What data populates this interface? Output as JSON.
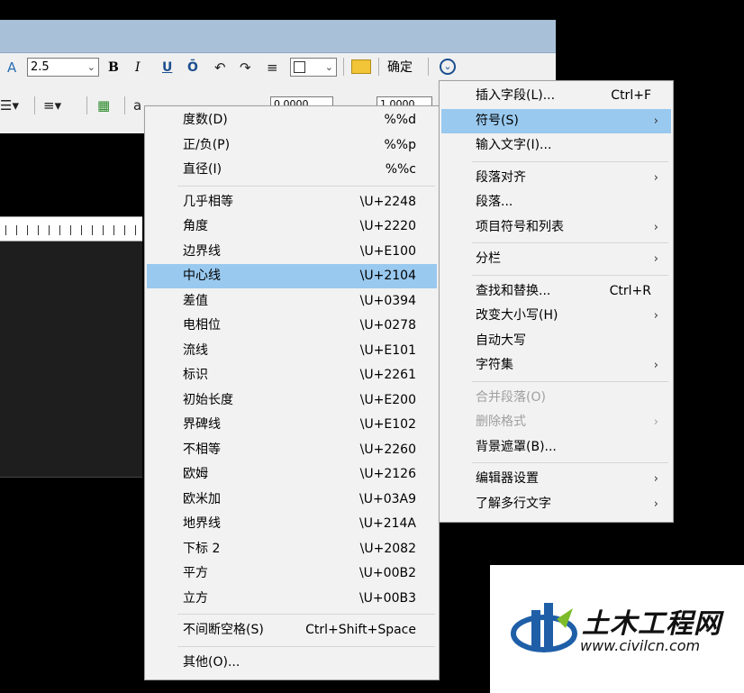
{
  "toolbar": {
    "row1": {
      "text_height_value": "2.5",
      "bold_label": "B",
      "italic_label": "I",
      "underline_label": "U",
      "overline_label": "Ō",
      "confirm_label": "确定"
    },
    "row2": {
      "oblique_value": "0.0000",
      "tracking_value": "1.0000"
    }
  },
  "symbol_menu": {
    "groups": [
      [
        {
          "label": "度数(D)",
          "code": "%%d"
        },
        {
          "label": "正/负(P)",
          "code": "%%p"
        },
        {
          "label": "直径(I)",
          "code": "%%c"
        }
      ],
      [
        {
          "label": "几乎相等",
          "code": "\\U+2248"
        },
        {
          "label": "角度",
          "code": "\\U+2220"
        },
        {
          "label": "边界线",
          "code": "\\U+E100"
        },
        {
          "label": "中心线",
          "code": "\\U+2104"
        },
        {
          "label": "差值",
          "code": "\\U+0394"
        },
        {
          "label": "电相位",
          "code": "\\U+0278"
        },
        {
          "label": "流线",
          "code": "\\U+E101"
        },
        {
          "label": "标识",
          "code": "\\U+2261"
        },
        {
          "label": "初始长度",
          "code": "\\U+E200"
        },
        {
          "label": "界碑线",
          "code": "\\U+E102"
        },
        {
          "label": "不相等",
          "code": "\\U+2260"
        },
        {
          "label": "欧姆",
          "code": "\\U+2126"
        },
        {
          "label": "欧米加",
          "code": "\\U+03A9"
        },
        {
          "label": "地界线",
          "code": "\\U+214A"
        },
        {
          "label": "下标 2",
          "code": "\\U+2082"
        },
        {
          "label": "平方",
          "code": "\\U+00B2"
        },
        {
          "label": "立方",
          "code": "\\U+00B3"
        }
      ],
      [
        {
          "label": "不间断空格(S)",
          "code": "Ctrl+Shift+Space"
        }
      ],
      [
        {
          "label": "其他(O)...",
          "code": ""
        }
      ]
    ],
    "highlighted": "中心线"
  },
  "options_menu": {
    "items": [
      {
        "label": "插入字段(L)...",
        "shortcut": "Ctrl+F"
      },
      {
        "label": "符号(S)",
        "arrow": "›"
      },
      {
        "label": "输入文字(I)..."
      },
      {
        "label": "段落对齐",
        "arrow": "›"
      },
      {
        "label": "段落..."
      },
      {
        "label": "项目符号和列表",
        "arrow": "›"
      },
      {
        "label": "分栏",
        "arrow": "›"
      },
      {
        "label": "查找和替换...",
        "shortcut": "Ctrl+R"
      },
      {
        "label": "改变大小写(H)",
        "arrow": "›"
      },
      {
        "label": "自动大写"
      },
      {
        "label": "字符集",
        "arrow": "›"
      },
      {
        "label": "合并段落(O)",
        "disabled": true
      },
      {
        "label": "删除格式",
        "arrow": "›",
        "disabled": true
      },
      {
        "label": "背景遮罩(B)..."
      },
      {
        "label": "编辑器设置",
        "arrow": "›"
      },
      {
        "label": "了解多行文字",
        "arrow": "›"
      }
    ],
    "highlighted": "符号(S)"
  },
  "watermark": {
    "name": "土木工程网",
    "url": "www.civilcn.com"
  },
  "colors": {
    "highlight": "#99c9ef",
    "menu_bg": "#f2f2f2",
    "logo_blue": "#1f5fa8",
    "logo_green": "#7dbb2a"
  }
}
